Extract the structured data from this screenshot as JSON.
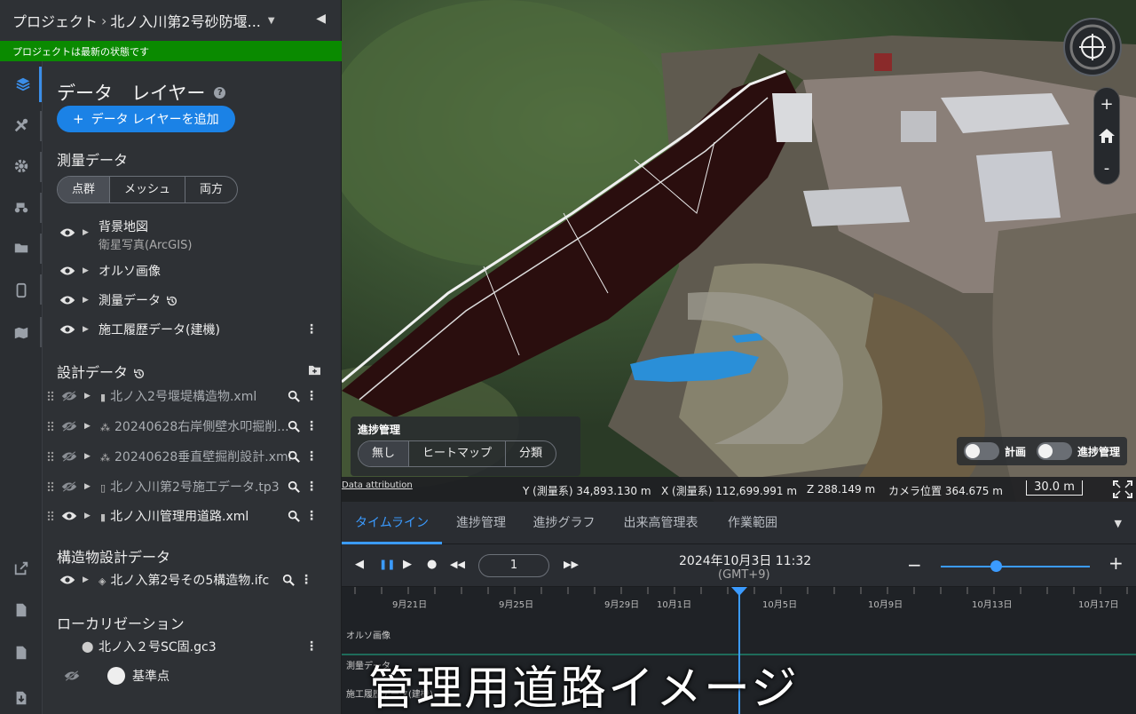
{
  "breadcrumb": {
    "root": "プロジェクト",
    "separator": "›",
    "current": "北ノ入川第2号砂防堰..."
  },
  "status": {
    "message": "プロジェクトは最新の状態です",
    "color": "#0a8a00"
  },
  "rail": {
    "icons": [
      "layers-icon",
      "tools-icon",
      "gear-icon",
      "machine-icon",
      "folder-icon",
      "phone-icon",
      "map-icon",
      "export-icon",
      "csv-icon",
      "pdf-icon",
      "download-icon"
    ]
  },
  "panel": {
    "title": "データ　レイヤー",
    "add_button": "データ レイヤーを追加",
    "survey": {
      "title": "測量データ",
      "segments": [
        "点群",
        "メッシュ",
        "両方"
      ],
      "selected": "点群",
      "items": [
        {
          "label": "背景地図",
          "sub": "衛星写真(ArcGIS)"
        },
        {
          "label": "オルソ画像"
        },
        {
          "label": "測量データ"
        },
        {
          "label": "施工履歴データ(建機)"
        }
      ]
    },
    "design": {
      "title": "設計データ",
      "items": [
        {
          "label": "北ノ入2号堰堤構造物.xml",
          "visible": false
        },
        {
          "label": "20240628右岸側壁水叩掘削...",
          "visible": false
        },
        {
          "label": "20240628垂直壁掘削設計.xml",
          "visible": false
        },
        {
          "label": "北ノ入川第2号施工データ.tp3",
          "visible": false
        },
        {
          "label": "北ノ入川管理用道路.xml",
          "visible": true
        }
      ]
    },
    "structure": {
      "title": "構造物設計データ",
      "item": "北ノ入第2号その5構造物.ifc"
    },
    "localization": {
      "title": "ローカリゼーション",
      "item": "北ノ入２号SC固.gc3",
      "sub_item": "基準点"
    }
  },
  "map": {
    "progress": {
      "title": "進捗管理",
      "options": [
        "無し",
        "ヒートマップ",
        "分類"
      ],
      "selected": "無し"
    },
    "toggles": {
      "plan": "計画",
      "progress": "進捗管理"
    },
    "attribution": "Data attribution",
    "coords": {
      "y": "Y (測量系) 34,893.130 m",
      "x": "X (測量系) 112,699.991 m",
      "z": "Z 288.149 m",
      "camera": "カメラ位置 364.675 m"
    },
    "scale": "30.0 m",
    "zoom_in": "+",
    "zoom_out": "-"
  },
  "bottom": {
    "tabs": [
      "タイムライン",
      "進捗管理",
      "進捗グラフ",
      "出来高管理表",
      "作業範囲"
    ],
    "active_tab": "タイムライン",
    "frame": "1",
    "datetime": "2024年10月3日 11:32",
    "timezone": "(GMT+9)",
    "zoom_level": 0.37,
    "ticks": [
      "9月21日",
      "9月25日",
      "9月29日",
      "10月1日",
      "10月5日",
      "10月9日",
      "10月13日",
      "10月17日"
    ],
    "tracks": [
      "オルソ画像",
      "測量データ",
      "施工履歴データ(建機)"
    ]
  },
  "caption": "管理用道路イメージ"
}
